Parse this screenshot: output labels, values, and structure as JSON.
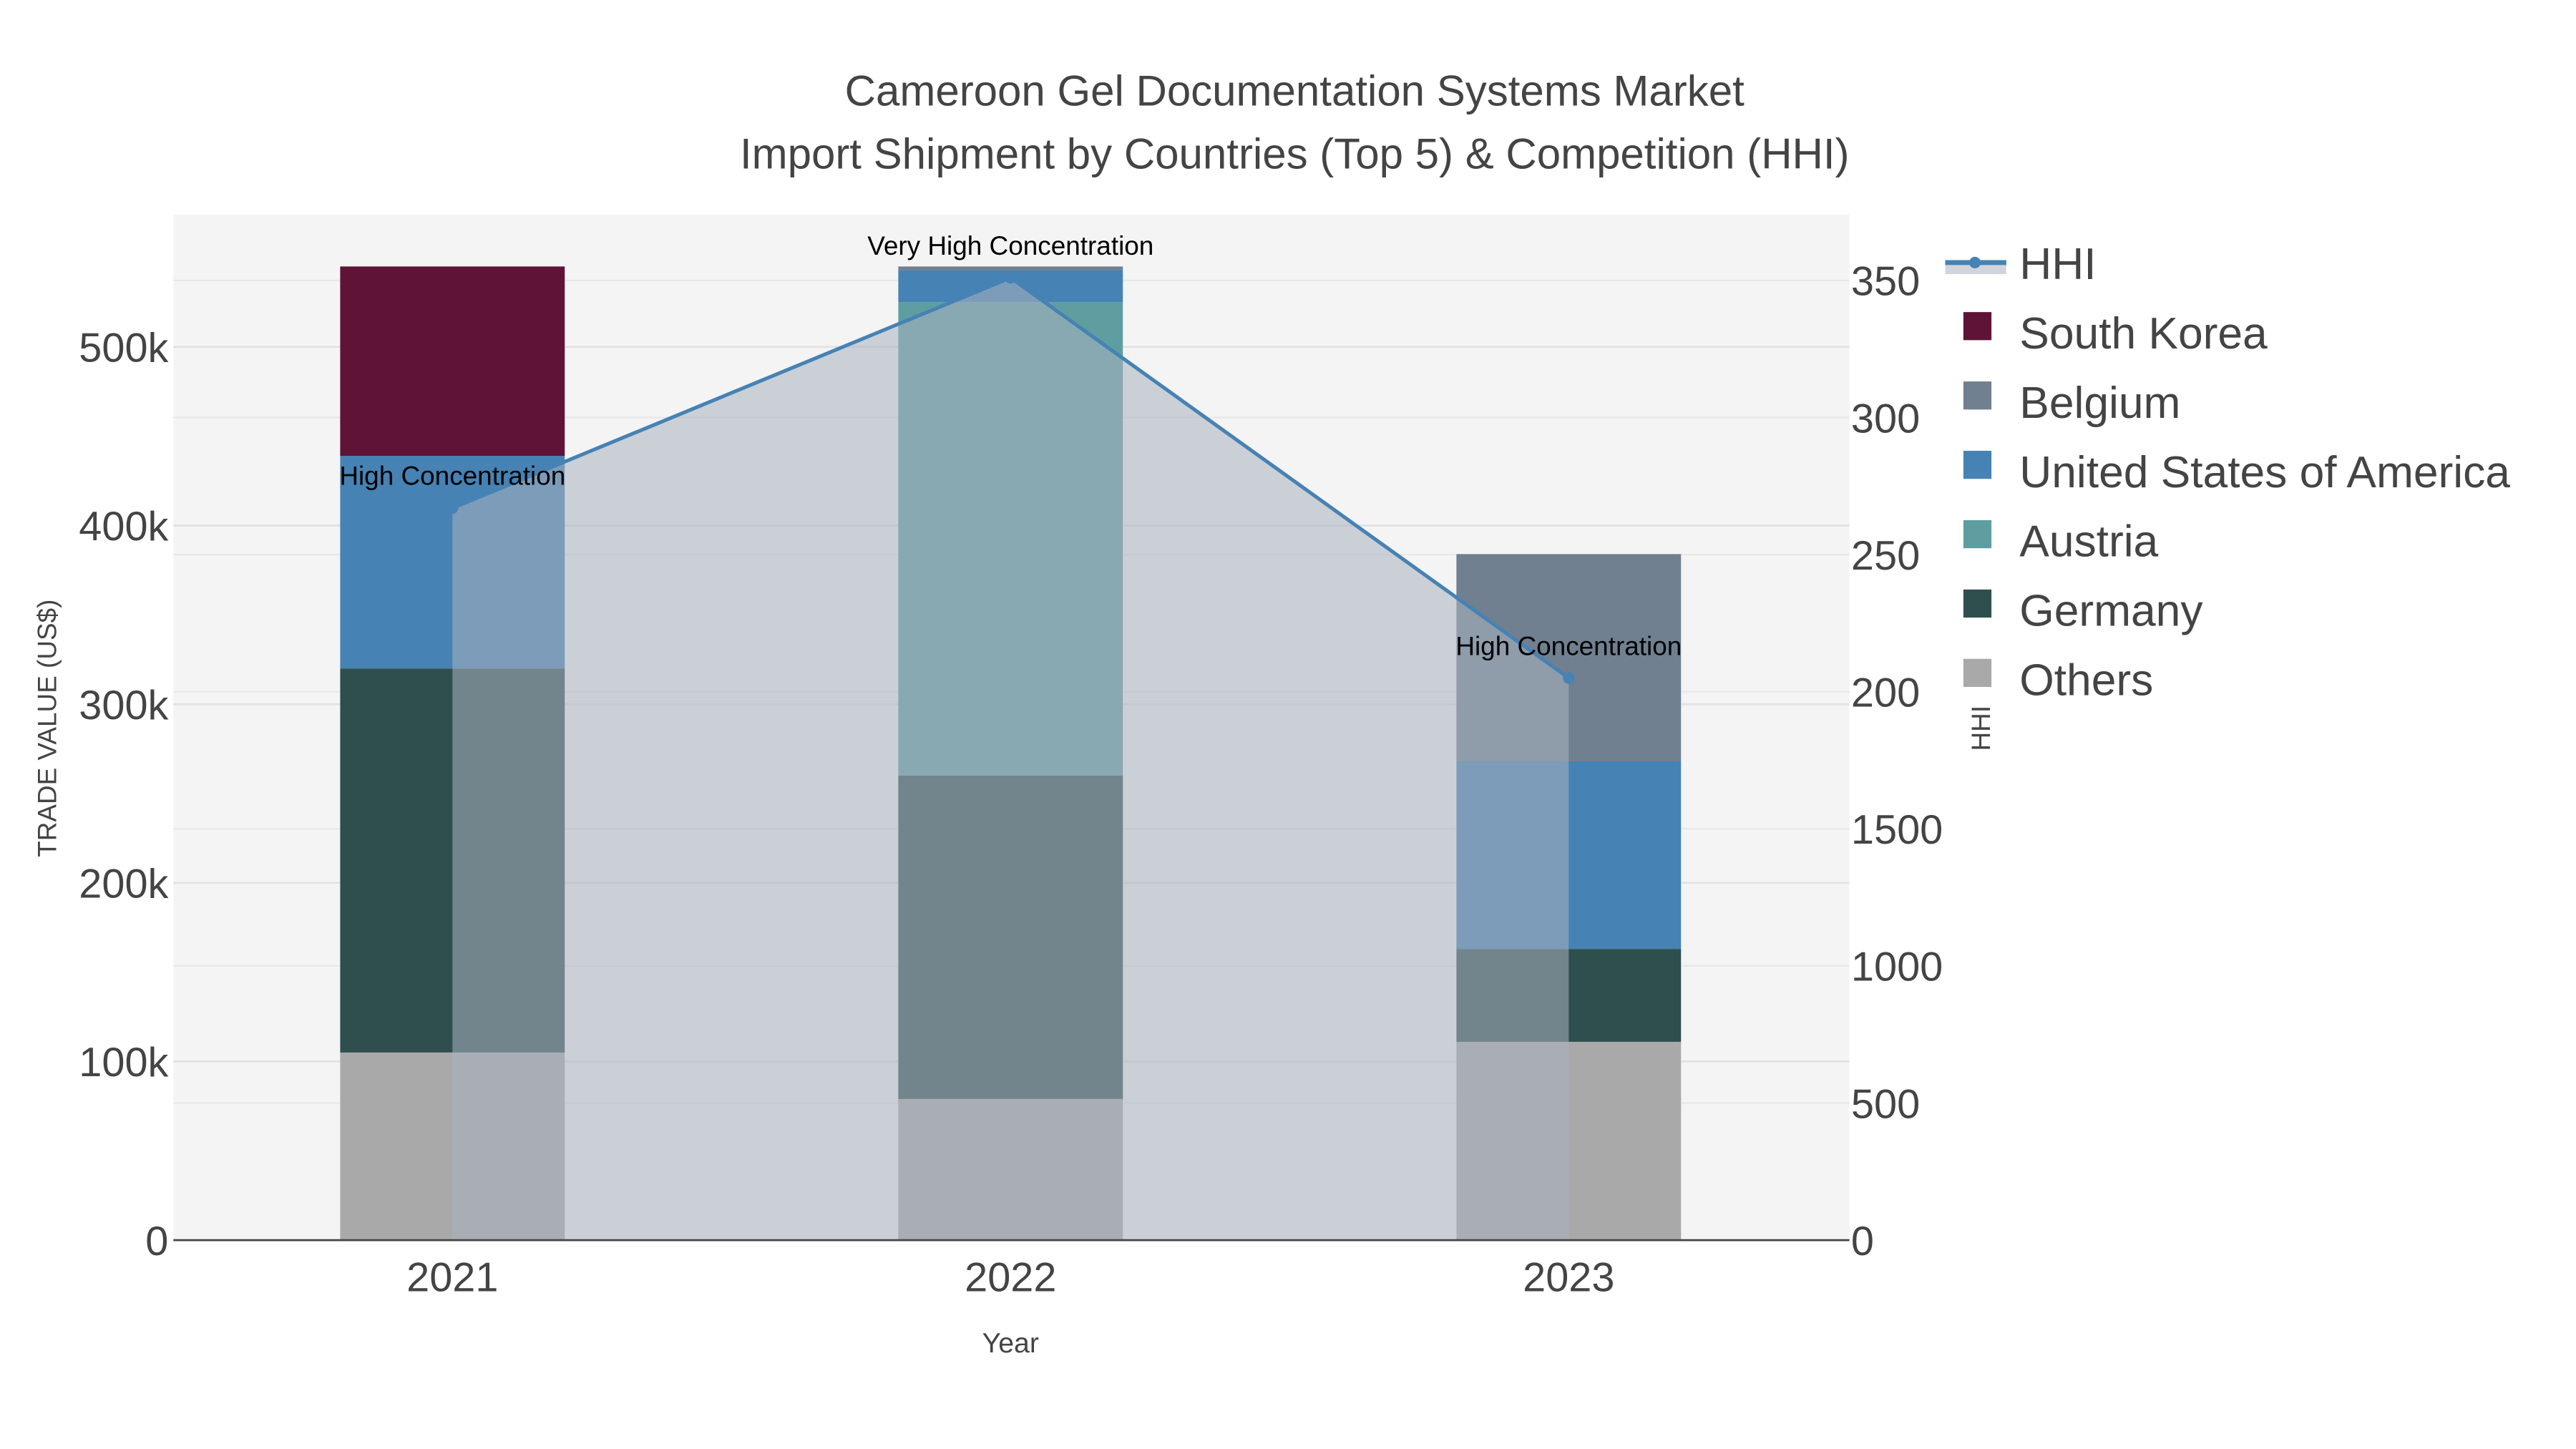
{
  "chart_data": {
    "type": "bar",
    "stacked": true,
    "title": "Cameroon Gel Documentation Systems Market",
    "subtitle": "Import Shipment by Countries (Top 5) & Competition (HHI)",
    "xlabel": "Year",
    "ylabel": "TRADE VALUE (US$)",
    "y2label": "HHI",
    "categories": [
      "2021",
      "2022",
      "2023"
    ],
    "ylim": [
      0,
      574000
    ],
    "y_ticks": [
      0,
      100000,
      200000,
      300000,
      400000,
      500000
    ],
    "y_tick_labels": [
      "0",
      "100k",
      "200k",
      "300k",
      "400k",
      "500k"
    ],
    "y2lim": [
      0,
      3740
    ],
    "y2_ticks": [
      0,
      500,
      1000,
      1500,
      2000,
      2500,
      3000,
      3500
    ],
    "y2_tick_labels": [
      "0",
      "500",
      "1000",
      "1500",
      "200",
      "250",
      "300",
      "350"
    ],
    "grid": true,
    "legend_position": "right",
    "series": [
      {
        "name": "Others",
        "color": "#a9a9a9",
        "values": [
          105000,
          79000,
          111000
        ]
      },
      {
        "name": "Germany",
        "color": "#2f4f4f",
        "values": [
          215000,
          181000,
          52000
        ]
      },
      {
        "name": "Austria",
        "color": "#5f9ea0",
        "values": [
          0,
          265000,
          0
        ]
      },
      {
        "name": "United States of America",
        "color": "#4682b4",
        "values": [
          119000,
          18000,
          105000
        ]
      },
      {
        "name": "Belgium",
        "color": "#708090",
        "values": [
          0,
          2000,
          116000
        ]
      },
      {
        "name": "South Korea",
        "color": "#5f1336",
        "values": [
          106000,
          0,
          0
        ]
      }
    ],
    "legend_order": [
      "HHI",
      "South Korea",
      "Belgium",
      "United States of America",
      "Austria",
      "Germany",
      "Others"
    ],
    "hhi": {
      "name": "HHI",
      "color": "#4682b4",
      "values": [
        2670,
        3510,
        2050
      ],
      "annotations": [
        "High Concentration",
        "Very High Concentration",
        "High Concentration"
      ]
    }
  }
}
